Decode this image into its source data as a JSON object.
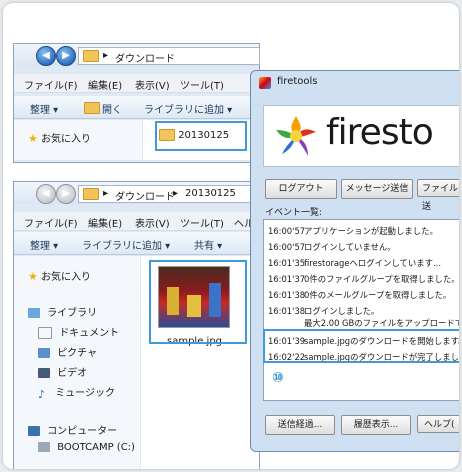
{
  "window1": {
    "path": "ダウンロード",
    "menus": [
      "ファイル(F)",
      "編集(E)",
      "表示(V)",
      "ツール(T)"
    ],
    "toolbar": [
      "整理 ▾",
      "開く",
      "ライブラリに追加 ▾"
    ],
    "favorites": "お気に入り",
    "folder_item": "20130125"
  },
  "window2": {
    "path": [
      "ダウンロード",
      "20130125"
    ],
    "menus": [
      "ファイル(F)",
      "編集(E)",
      "表示(V)",
      "ツール(T)",
      "ヘル"
    ],
    "toolbar": [
      "整理 ▾",
      "ライブラリに追加 ▾",
      "共有 ▾"
    ],
    "favorites": "お気に入り",
    "libraries": "ライブラリ",
    "library_items": [
      "ドキュメント",
      "ピクチャ",
      "ビデオ",
      "ミュージック"
    ],
    "computer": "コンピューター",
    "drives": [
      "BOOTCAMP (C:)"
    ],
    "file_name": "sample.jpg"
  },
  "firetools": {
    "title": "firetools",
    "logo_text": "firesto",
    "buttons": [
      "ログアウト",
      "メッセージ送信",
      "ファイル送"
    ],
    "events_label": "イベント一覧:",
    "log": [
      {
        "time": "16:00'57",
        "msg": "アプリケーションが起動しました。"
      },
      {
        "time": "16:00'57",
        "msg": "ログインしていません。"
      },
      {
        "time": "16:01'35",
        "msg": "firestorageへログインしています..."
      },
      {
        "time": "16:01'37",
        "msg": "0件のファイルグループを取得しました。"
      },
      {
        "time": "16:01'38",
        "msg": "0件のメールグループを取得しました。"
      },
      {
        "time": "16:01'38",
        "msg": "ログインしました。"
      },
      {
        "time": "",
        "msg": "最大2.00 GBのファイルをアップロードでき"
      },
      {
        "time": "16:01'39",
        "msg": "sample.jpgのダウンロードを開始します。"
      },
      {
        "time": "16:02'22",
        "msg": "sample.jpgのダウンロードが完了しました"
      }
    ],
    "step_badge": "⑩",
    "bottom_buttons": [
      "送信経過...",
      "履歴表示...",
      "ヘルプ("
    ]
  }
}
